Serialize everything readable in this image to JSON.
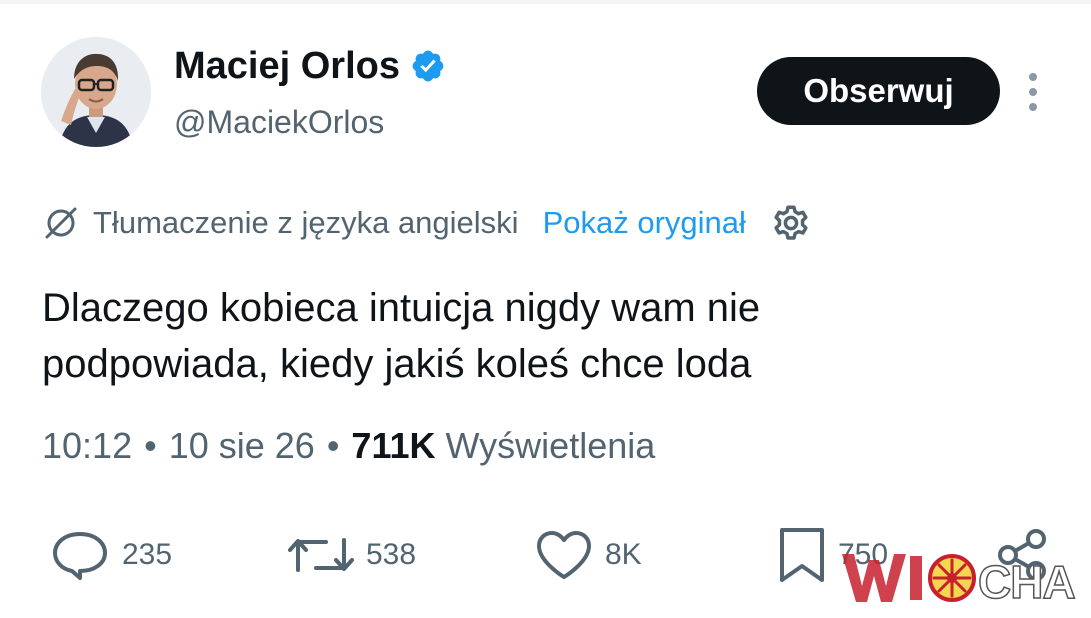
{
  "author": {
    "display_name": "Maciej Orlos",
    "handle": "@MaciekOrlos",
    "verified": true
  },
  "follow_button": {
    "label": "Obserwuj"
  },
  "translation": {
    "label": "Tłumaczenie z języka angielski",
    "show_original": "Pokaż oryginał"
  },
  "tweet": {
    "lines": [
      "Dlaczego kobieca intuicja nigdy wam nie",
      "podpowiada, kiedy jakiś koleś chce loda"
    ]
  },
  "meta": {
    "time": "10:12",
    "date": "10 sie 26",
    "separator": "•",
    "views_count": "711K",
    "views_label": "Wyświetlenia"
  },
  "actions": {
    "replies": "235",
    "reposts": "538",
    "likes": "8K",
    "bookmarks": "750"
  },
  "watermark": {
    "logo": "WIOCHA"
  },
  "colors": {
    "text": "#0f1419",
    "secondary": "#536471",
    "link": "#1d9bf0",
    "verified": "#1d9bf0",
    "follow_bg": "#0f1419",
    "watermark_red": "#c8202f"
  },
  "icons": {
    "verified": "verified-badge-icon",
    "more": "more-vertical-icon",
    "translation": "translate-icon",
    "settings": "gear-icon",
    "reply": "reply-icon",
    "repost": "repost-icon",
    "like": "heart-icon",
    "bookmark": "bookmark-icon",
    "share": "share-icon"
  }
}
